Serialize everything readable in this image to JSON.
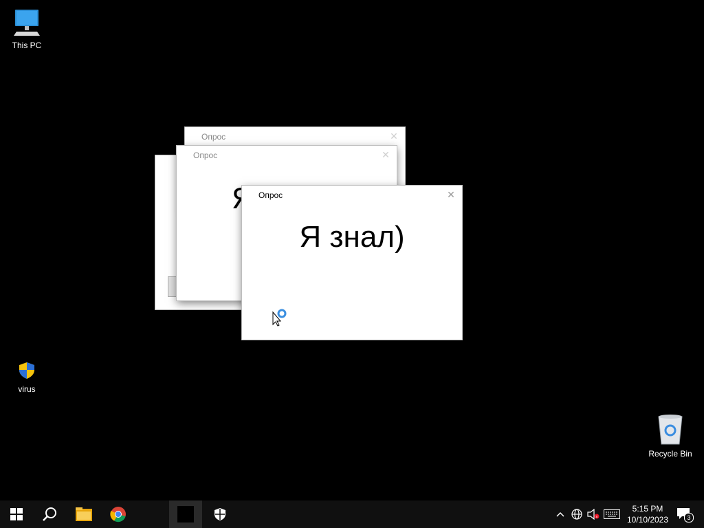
{
  "desktop": {
    "icons": [
      {
        "label": "This PC"
      },
      {
        "label": "virus"
      },
      {
        "label": "Recycle Bin"
      }
    ]
  },
  "dialogs": [
    {
      "title": "Опрос",
      "message": ""
    },
    {
      "title": "Опрос",
      "message": ""
    },
    {
      "title": "Опрос",
      "message": "Я знал)"
    }
  ],
  "background_text": "",
  "taskbar": {
    "pinned": [
      "start-icon",
      "search-icon",
      "file-explorer-icon",
      "chrome-icon",
      "app-window-icon",
      "shield-icon"
    ],
    "tray_icons": [
      "chevron-up-icon",
      "network-globe-icon",
      "volume-muted-icon",
      "keyboard-icon"
    ],
    "clock_time": "5:15 PM",
    "clock_date": "10/10/2023",
    "notification_count": "3"
  },
  "colors": {
    "desktop": "#000000",
    "taskbar": "#101010",
    "accent": "#76b9ed"
  }
}
